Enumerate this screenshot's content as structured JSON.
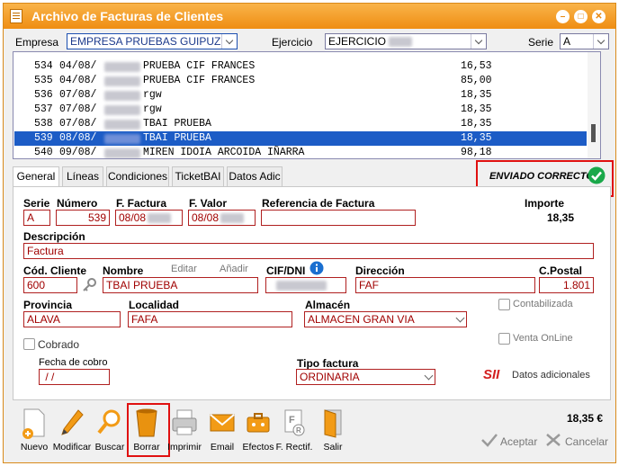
{
  "title": "Archivo de Facturas de Clientes",
  "title_buttons": {
    "minimize": "–",
    "restore": "□",
    "close": "✕"
  },
  "header": {
    "empresa_label": "Empresa",
    "empresa_value": "EMPRESA PRUEBAS GUIPUZCOA",
    "ejercicio_label": "Ejercicio",
    "ejercicio_value": "EJERCICIO",
    "serie_label": "Serie",
    "serie_value": "A"
  },
  "invoices": [
    {
      "num": "534",
      "date": "04/08/",
      "name": "PRUEBA CIF FRANCES",
      "amount": "16,53",
      "selected": false
    },
    {
      "num": "535",
      "date": "04/08/",
      "name": "PRUEBA CIF FRANCES",
      "amount": "85,00",
      "selected": false
    },
    {
      "num": "536",
      "date": "07/08/",
      "name": "rgw",
      "amount": "18,35",
      "selected": false
    },
    {
      "num": "537",
      "date": "07/08/",
      "name": "rgw",
      "amount": "18,35",
      "selected": false
    },
    {
      "num": "538",
      "date": "07/08/",
      "name": "TBAI PRUEBA",
      "amount": "18,35",
      "selected": false
    },
    {
      "num": "539",
      "date": "08/08/",
      "name": "TBAI PRUEBA",
      "amount": "18,35",
      "selected": true
    },
    {
      "num": "540",
      "date": "09/08/",
      "name": "MIREN IDOIA ARCOIDA IÑARRA",
      "amount": "98,18",
      "selected": false
    }
  ],
  "tabs": [
    "General",
    "Líneas",
    "Condiciones",
    "TicketBAI",
    "Datos Adic"
  ],
  "status": {
    "text": "ENVIADO CORRECTO",
    "color": "#1aa84a"
  },
  "form": {
    "serie_label": "Serie",
    "serie": "A",
    "numero_label": "Número",
    "numero": "539",
    "ffactura_label": "F. Factura",
    "ffactura": "08/08",
    "fvalor_label": "F. Valor",
    "fvalor": "08/08",
    "referencia_label": "Referencia de Factura",
    "referencia": "",
    "importe_label": "Importe",
    "importe": "18,35",
    "descripcion_label": "Descripción",
    "descripcion": "Factura",
    "codcliente_label": "Cód. Cliente",
    "codcliente": "600",
    "nombre_label": "Nombre",
    "nombre": "TBAI PRUEBA",
    "editar": "Editar",
    "anadir": "Añadir",
    "cif_label": "CIF/DNI",
    "cif": "",
    "direccion_label": "Dirección",
    "direccion": "FAF",
    "cpostal_label": "C.Postal",
    "cpostal": "1.801",
    "provincia_label": "Provincia",
    "provincia": "ALAVA",
    "localidad_label": "Localidad",
    "localidad": "FAFA",
    "almacen_label": "Almacén",
    "almacen": "ALMACEN GRAN VIA",
    "contabilizada_label": "Contabilizada",
    "cobrado_label": "Cobrado",
    "venta_online_label": "Venta OnLine",
    "fecha_cobro_label": "Fecha de cobro",
    "fecha_cobro": " / /",
    "tipo_factura_label": "Tipo factura",
    "tipo_factura": "ORDINARIA",
    "sii_label": "SII",
    "datos_adicionales_label": "Datos adicionales"
  },
  "footer": {
    "total": "18,35 €",
    "aceptar": "Aceptar",
    "cancelar": "Cancelar"
  },
  "toolbar": [
    "Nuevo",
    "Modificar",
    "Buscar",
    "Borrar",
    "Imprimir",
    "Email",
    "Efectos",
    "F. Rectif.",
    "Salir"
  ]
}
